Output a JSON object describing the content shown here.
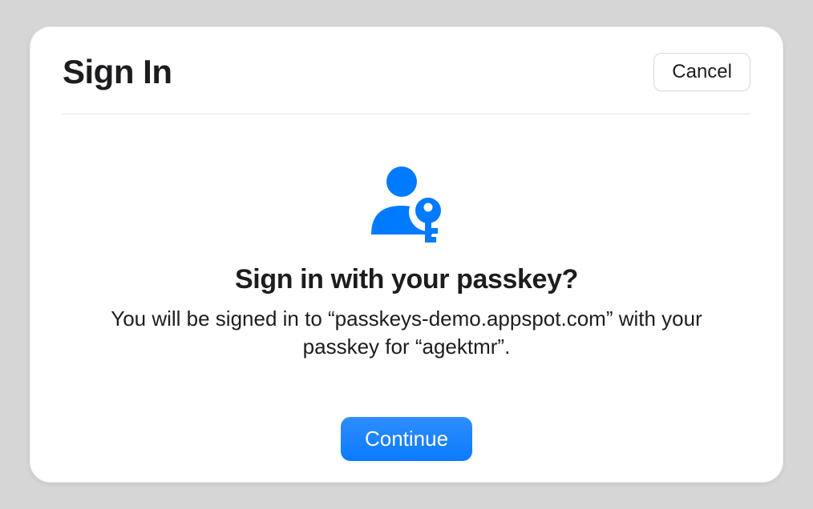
{
  "dialog": {
    "title": "Sign In",
    "cancel_label": "Cancel",
    "heading": "Sign in with your passkey?",
    "body_text": "You will be signed in to “passkeys-demo.appspot.com” with your passkey for “agektmr”.",
    "continue_label": "Continue",
    "accent_color": "#007aff"
  }
}
